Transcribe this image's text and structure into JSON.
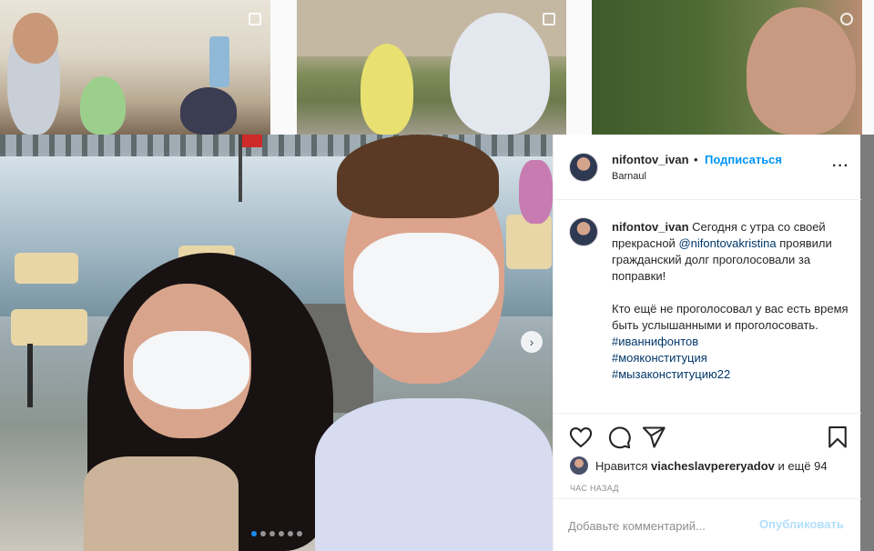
{
  "grid": {
    "thumb_names": [
      "grid-thumb-1",
      "grid-thumb-2",
      "grid-thumb-3"
    ]
  },
  "post": {
    "username": "nifontov_ivan",
    "dot": "•",
    "follow_label": "Подписаться",
    "location": "Barnaul",
    "more_icon": "more-horizontal-icon",
    "caption": {
      "username": "nifontov_ivan",
      "line1": "Сегодня с утра со своей прекрасной",
      "mention": "@nifontovakristina",
      "line2": "проявили гражданский долг проголосовали за поправки!",
      "line3": "Кто ещё не проголосовал у вас есть время быть услышанными и проголосовать.",
      "hashtags": [
        "#иваннифонтов",
        "#мояконституция",
        "#мызаконституцию22"
      ]
    },
    "carousel": {
      "slides": 6,
      "active_index": 0,
      "next_icon": "chevron-right-icon"
    },
    "actions": {
      "like_icon": "heart-icon",
      "comment_icon": "comment-icon",
      "share_icon": "paper-plane-icon",
      "save_icon": "bookmark-icon"
    },
    "likes": {
      "prefix": "Нравится",
      "user": "viacheslavpereryadov",
      "suffix": "и ещё 94"
    },
    "time_ago": "ЧАС НАЗАД",
    "comment": {
      "placeholder": "Добавьте комментарий...",
      "publish_label": "Опубликовать"
    }
  }
}
